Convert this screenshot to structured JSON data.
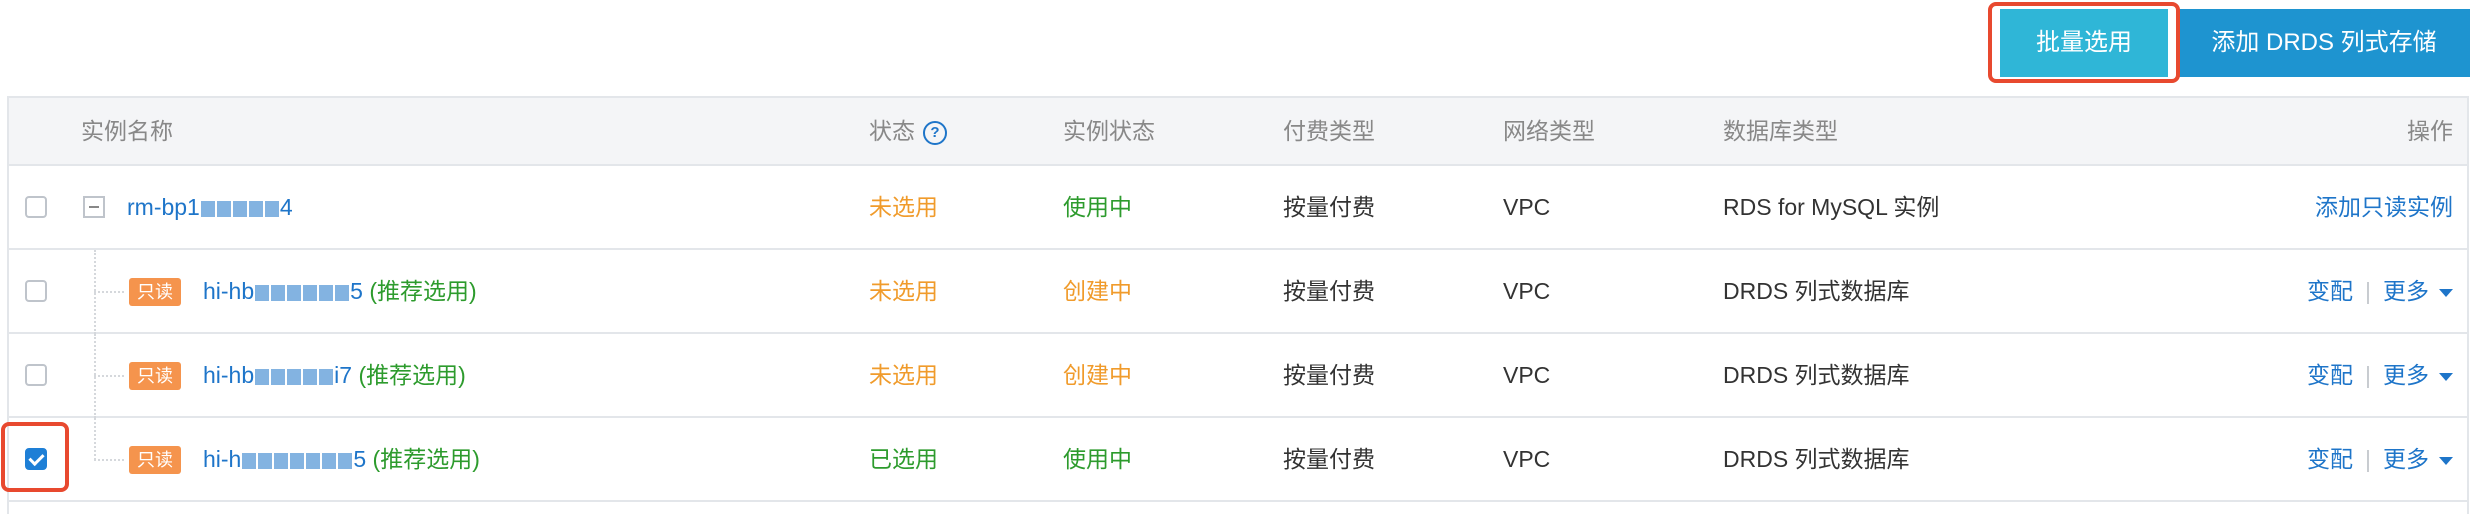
{
  "toolbar": {
    "batch_select_label": "批量选用",
    "add_drds_label": "添加 DRDS 列式存储"
  },
  "table": {
    "headers": {
      "name": "实例名称",
      "status": "状态",
      "instance_status": "实例状态",
      "pay_type": "付费类型",
      "network": "网络类型",
      "db_type": "数据库类型",
      "actions": "操作"
    },
    "help_icon": "question-circle-icon",
    "rows": [
      {
        "name": "rm-bp1",
        "name_suffix": "4",
        "status": "未选用",
        "instance_status": "使用中",
        "pay_type": "按量付费",
        "network": "VPC",
        "db_type": "RDS for MySQL 实例",
        "action": "添加只读实例",
        "checked": false
      },
      {
        "tag": "只读",
        "name": "hi-hb",
        "name_suffix": "5",
        "recommend": "(推荐选用)",
        "status": "未选用",
        "instance_status": "创建中",
        "pay_type": "按量付费",
        "network": "VPC",
        "db_type": "DRDS 列式数据库",
        "action_change": "变配",
        "action_more": "更多",
        "checked": false
      },
      {
        "tag": "只读",
        "name": "hi-hb",
        "name_suffix": "i7",
        "recommend": "(推荐选用)",
        "status": "未选用",
        "instance_status": "创建中",
        "pay_type": "按量付费",
        "network": "VPC",
        "db_type": "DRDS 列式数据库",
        "action_change": "变配",
        "action_more": "更多",
        "checked": false
      },
      {
        "tag": "只读",
        "name": "hi-h",
        "name_suffix": "5",
        "recommend": "(推荐选用)",
        "status": "已选用",
        "instance_status": "使用中",
        "pay_type": "按量付费",
        "network": "VPC",
        "db_type": "DRDS 列式数据库",
        "action_change": "变配",
        "action_more": "更多",
        "checked": true
      }
    ]
  },
  "colors": {
    "primary_button": "#2fb6d7",
    "secondary_button": "#1e94d0",
    "highlight": "#e8492f",
    "link": "#1e75c9",
    "green": "#2d9b2d",
    "orange": "#f09b2b",
    "tag": "#f5944d"
  }
}
